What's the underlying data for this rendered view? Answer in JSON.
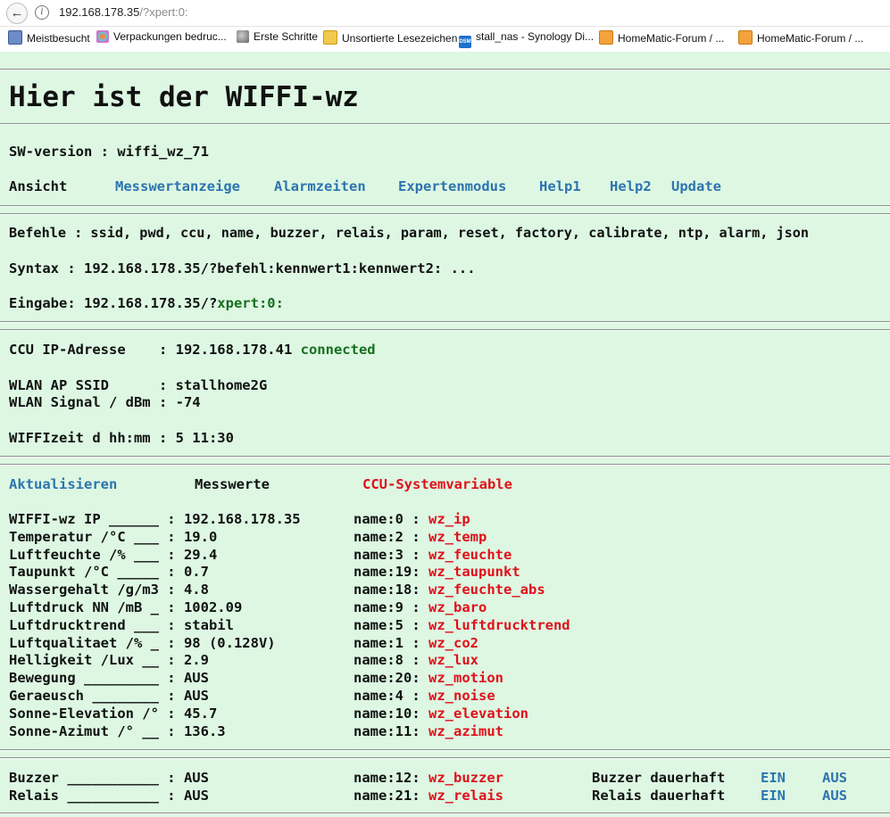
{
  "browser": {
    "url_host": "192.168.178.35",
    "url_rest": "/?xpert:0:",
    "bookmarks": [
      {
        "label": "Meistbesucht",
        "icon": "bookmark-book-icon"
      },
      {
        "label": "Verpackungen bedruc...",
        "icon": "site-flower-icon"
      },
      {
        "label": "Erste Schritte",
        "icon": "globe-icon"
      },
      {
        "label": "Unsortierte Lesezeichen",
        "icon": "folder-icon"
      },
      {
        "label": "stall_nas - Synology Di...",
        "icon": "dsm-icon"
      },
      {
        "label": "HomeMatic-Forum / ...",
        "icon": "rss-icon"
      },
      {
        "label": "HomeMatic-Forum / ...",
        "icon": "rss-icon"
      }
    ]
  },
  "page": {
    "title": "Hier ist der WIFFI-wz",
    "sw_version": "SW-version : wiffi_wz_71",
    "nav": {
      "label": "Ansicht",
      "links": [
        "Messwertanzeige",
        "Alarmzeiten",
        "Expertenmodus",
        "Help1",
        "Help2",
        "Update"
      ]
    },
    "commands": "Befehle : ssid, pwd, ccu, name, buzzer, relais, param, reset, factory, calibrate, ntp, alarm, json",
    "syntax": "Syntax : 192.168.178.35/?befehl:kennwert1:kennwert2: ...",
    "input_label": "Eingabe: 192.168.178.35/?",
    "input_value": "xpert:0:",
    "status": {
      "ccu_label": "CCU IP-Adresse    : 192.168.178.41",
      "ccu_state": "connected",
      "ssid": "WLAN AP SSID      : stallhome2G",
      "signal": "WLAN Signal / dBm : -74",
      "time": "WIFFIzeit d hh:mm : 5 11:30"
    },
    "measure_header": {
      "refresh": "Aktualisieren",
      "values": "Messwerte",
      "ccu_vars": "CCU-Systemvariable"
    },
    "measurements": [
      {
        "label": "WIFFI-wz IP ______ : 192.168.178.35",
        "name": "name:0 : ",
        "var": "wz_ip"
      },
      {
        "label": "Temperatur /°C ___ : 19.0",
        "name": "name:2 : ",
        "var": "wz_temp"
      },
      {
        "label": "Luftfeuchte /% ___ : 29.4",
        "name": "name:3 : ",
        "var": "wz_feuchte"
      },
      {
        "label": "Taupunkt /°C _____ : 0.7",
        "name": "name:19: ",
        "var": "wz_taupunkt"
      },
      {
        "label": "Wassergehalt /g/m3 : 4.8",
        "name": "name:18: ",
        "var": "wz_feuchte_abs"
      },
      {
        "label": "Luftdruck NN /mB _ : 1002.09",
        "name": "name:9 : ",
        "var": "wz_baro"
      },
      {
        "label": "Luftdrucktrend ___ : stabil",
        "name": "name:5 : ",
        "var": "wz_luftdrucktrend"
      },
      {
        "label": "Luftqualitaet /% _ : 98 (0.128V)",
        "name": "name:1 : ",
        "var": "wz_co2"
      },
      {
        "label": "Helligkeit /Lux __ : 2.9",
        "name": "name:8 : ",
        "var": "wz_lux"
      },
      {
        "label": "Bewegung _________ : AUS",
        "name": "name:20: ",
        "var": "wz_motion"
      },
      {
        "label": "Geraeusch ________ : AUS",
        "name": "name:4 : ",
        "var": "wz_noise"
      },
      {
        "label": "Sonne-Elevation /° : 45.7",
        "name": "name:10: ",
        "var": "wz_elevation"
      },
      {
        "label": "Sonne-Azimut /° __ : 136.3",
        "name": "name:11: ",
        "var": "wz_azimut"
      }
    ],
    "outputs": [
      {
        "label": "Buzzer ___________ : AUS",
        "name": "name:12: ",
        "var": "wz_buzzer",
        "perm": "Buzzer dauerhaft",
        "on": "EIN",
        "off": "AUS"
      },
      {
        "label": "Relais ___________ : AUS",
        "name": "name:21: ",
        "var": "wz_relais",
        "perm": "Relais dauerhaft",
        "on": "EIN",
        "off": "AUS"
      }
    ]
  }
}
